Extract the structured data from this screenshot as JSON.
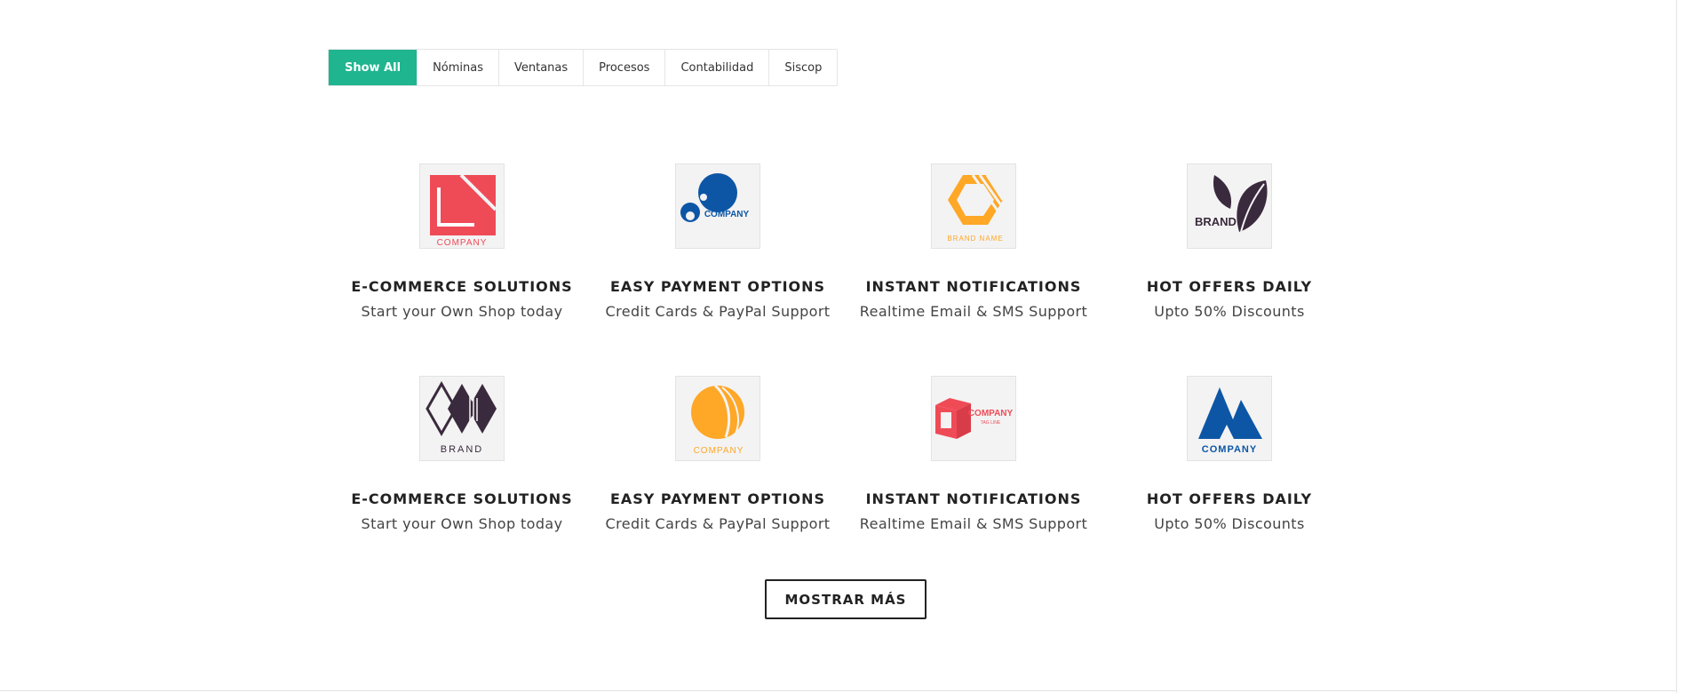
{
  "filters": [
    "Show All",
    "Nóminas",
    "Ventanas",
    "Procesos",
    "Contabilidad",
    "Siscop"
  ],
  "cards": [
    {
      "title": "E-COMMERCE SOLUTIONS",
      "subtitle": "Start your Own Shop today",
      "logo_text": "COMPANY",
      "logo": "red-square-logo"
    },
    {
      "title": "EASY PAYMENT OPTIONS",
      "subtitle": "Credit Cards & PayPal Support",
      "logo_text": "COMPANY",
      "logo": "blue-drop-logo"
    },
    {
      "title": "INSTANT NOTIFICATIONS",
      "subtitle": "Realtime Email & SMS Support",
      "logo_text": "BRAND NAME",
      "logo": "orange-hexagon-logo"
    },
    {
      "title": "HOT OFFERS DAILY",
      "subtitle": "Upto 50% Discounts",
      "logo_text": "BRAND",
      "logo": "leaf-logo"
    },
    {
      "title": "E-COMMERCE SOLUTIONS",
      "subtitle": "Start your Own Shop today",
      "logo_text": "BRAND",
      "logo": "diamond-logo"
    },
    {
      "title": "EASY PAYMENT OPTIONS",
      "subtitle": "Credit Cards & PayPal Support",
      "logo_text": "COMPANY",
      "logo": "orange-circle-logo"
    },
    {
      "title": "INSTANT NOTIFICATIONS",
      "subtitle": "Realtime Email & SMS Support",
      "logo_text": "COMPANY",
      "logo_tagline": "TAG LINE",
      "logo": "red-cube-logo"
    },
    {
      "title": "HOT OFFERS DAILY",
      "subtitle": "Upto 50% Discounts",
      "logo_text": "COMPANY",
      "logo": "blue-mountain-logo"
    }
  ],
  "more_button": "MOSTRAR MÁS",
  "colors": {
    "accent": "#1fb58f",
    "red": "#ef4b57",
    "blue": "#0d56a6",
    "orange": "#ffa726",
    "dark": "#3a2a3d"
  }
}
